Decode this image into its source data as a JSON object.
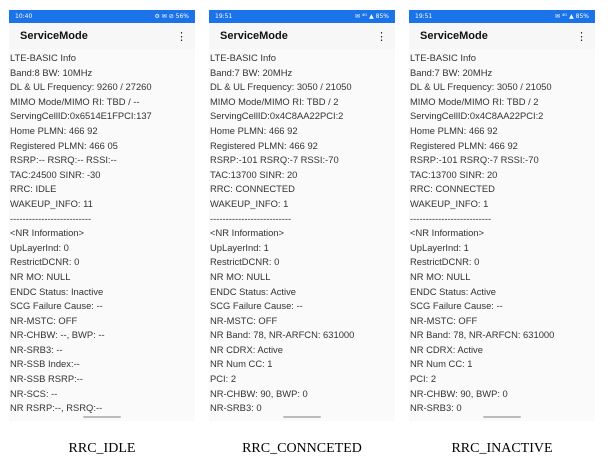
{
  "colors": {
    "statusbar": "#1a73e8",
    "text": "#333333",
    "background": "#fafafa"
  },
  "icons": {
    "menu": "more-vert-icon"
  },
  "screens": [
    {
      "status_time": "10:40",
      "status_icons": "⚙ ✉ ⊘ 56%",
      "app_title": "ServiceMode",
      "menu_glyph": "⋮",
      "caption": "RRC_IDLE",
      "lines": [
        "LTE-BASIC Info",
        "Band:8 BW: 10MHz",
        "DL & UL Frequency: 9260 / 27260",
        "MIMO Mode/MIMO RI: TBD / --",
        "ServingCellID:0x6514E1FPCI:137",
        "Home PLMN: 466 92",
        "Registered PLMN: 466 05",
        "RSRP:-- RSRQ:-- RSSI:--",
        "TAC:24500 SINR: -30",
        "RRC: IDLE",
        "WAKEUP_INFO: 11",
        "--------------------------",
        "<NR Information>",
        "UpLayerInd: 0",
        "RestrictDCNR: 0",
        "NR MO: NULL",
        "ENDC Status: Inactive",
        "SCG Failure Cause: --",
        "NR-MSTC: OFF",
        "NR-CHBW: --, BWP: --",
        "NR-SRB3: --",
        "NR-SSB Index:--",
        "NR-SSB RSRP:--",
        "NR-SCS: --",
        "NR RSRP:--, RSRQ:--"
      ]
    },
    {
      "status_time": "19:51",
      "status_icons": "✉ ⁴ᴳ ▲ 85%",
      "app_title": "ServiceMode",
      "menu_glyph": "⋮",
      "caption": "RRC_CONNCETED",
      "lines": [
        "LTE-BASIC Info",
        "Band:7 BW: 20MHz",
        "DL & UL Frequency: 3050 / 21050",
        "MIMO Mode/MIMO RI: TBD / 2",
        "ServingCellID:0x4C8AA22PCI:2",
        "Home PLMN: 466 92",
        "Registered PLMN: 466 92",
        "RSRP:-101 RSRQ:-7 RSSI:-70",
        "TAC:13700 SINR: 20",
        "RRC: CONNECTED",
        "WAKEUP_INFO: 1",
        "--------------------------",
        "<NR Information>",
        "UpLayerInd: 1",
        "RestrictDCNR: 0",
        "NR MO: NULL",
        "ENDC Status: Active",
        "SCG Failure Cause: --",
        "NR-MSTC: OFF",
        "NR Band: 78, NR-ARFCN: 631000",
        "NR CDRX: Active",
        "NR Num CC: 1",
        "PCI: 2",
        "NR-CHBW: 90, BWP: 0",
        "NR-SRB3: 0"
      ]
    },
    {
      "status_time": "19:51",
      "status_icons": "✉ ⁴ᴳ ▲ 85%",
      "app_title": "ServiceMode",
      "menu_glyph": "⋮",
      "caption": "RRC_INACTIVE",
      "lines": [
        "LTE-BASIC Info",
        "Band:7 BW: 20MHz",
        "DL & UL Frequency: 3050 / 21050",
        "MIMO Mode/MIMO RI: TBD / 2",
        "ServingCellID:0x4C8AA22PCI:2",
        "Home PLMN: 466 92",
        "Registered PLMN: 466 92",
        "RSRP:-101 RSRQ:-7 RSSI:-70",
        "TAC:13700 SINR: 20",
        "RRC: CONNECTED",
        "WAKEUP_INFO: 1",
        "--------------------------",
        "<NR Information>",
        "UpLayerInd: 1",
        "RestrictDCNR: 0",
        "NR MO: NULL",
        "ENDC Status: Active",
        "SCG Failure Cause: --",
        "NR-MSTC: OFF",
        "NR Band: 78, NR-ARFCN: 631000",
        "NR CDRX: Active",
        "NR Num CC: 1",
        "PCI: 2",
        "NR-CHBW: 90, BWP: 0",
        "NR-SRB3: 0"
      ]
    }
  ]
}
